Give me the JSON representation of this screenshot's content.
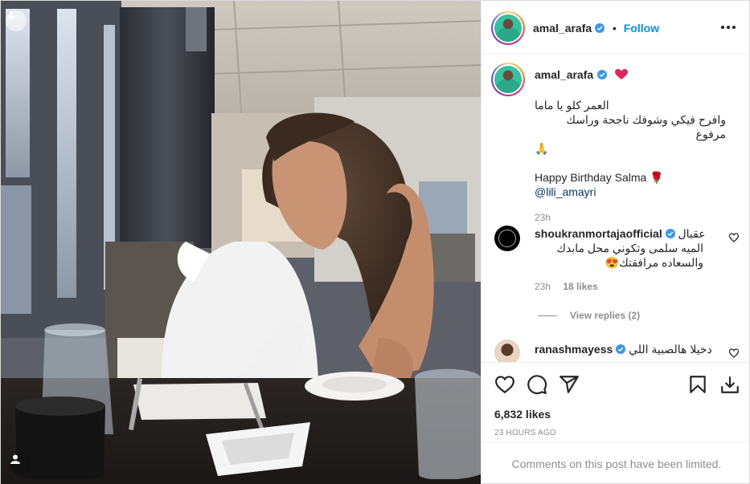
{
  "post": {
    "username": "amal_arafa",
    "follow_label": "Follow",
    "header_separator": "•"
  },
  "caption": {
    "username": "amal_arafa",
    "line1": "العمر كلو يا ماما",
    "line2": "وافرح فيكي وشوفك ناجحة وراسك مرفوع",
    "line3": "🙏",
    "line4": "Happy Birthday Salma 🌹",
    "mention": "@lili_amayri",
    "time": "23h"
  },
  "comments": [
    {
      "username": "shoukranmortajaofficial",
      "text_inline": "عقبال",
      "text_line2": "الميه سلمى وتكوني محل مابدك",
      "text_line3": "والسعاده مرافقتك😍",
      "time": "23h",
      "likes": "18 likes",
      "view_replies": "View replies (2)"
    },
    {
      "username": "ranashmayess",
      "text_inline": "دخيلا هالصبية اللي"
    }
  ],
  "stats": {
    "likes": "6,832 likes",
    "time_ago": "23 HOURS AGO"
  },
  "footer": {
    "limited": "Comments on this post have been limited."
  },
  "icons": [
    "download-icon",
    "user-tag-icon",
    "verified-icon",
    "more-options-icon",
    "heart-icon",
    "comment-icon",
    "share-icon",
    "save-icon",
    "download-arrow-icon"
  ],
  "colors": {
    "accent": "#0095f6",
    "verified": "#3897f0",
    "mention": "#00376b",
    "muted": "#8e8e8e"
  }
}
